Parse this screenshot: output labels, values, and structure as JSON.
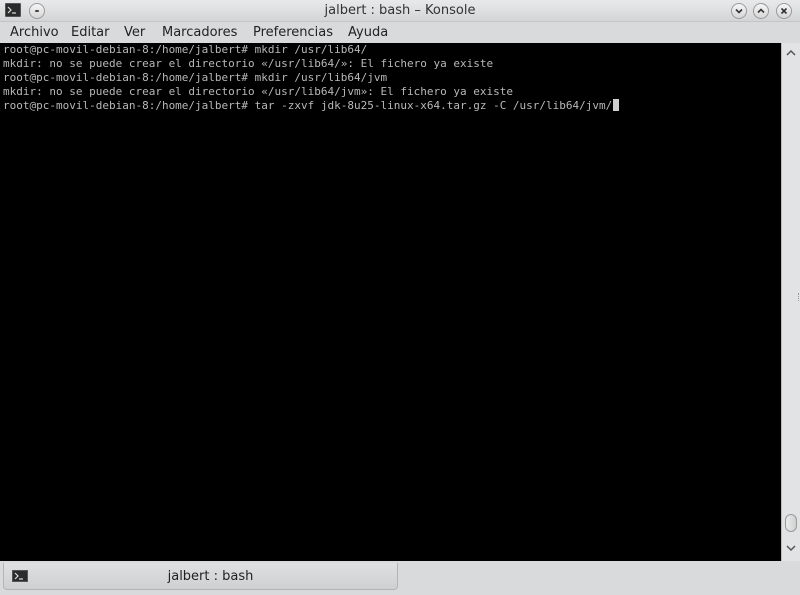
{
  "window": {
    "title": "jalbert : bash – Konsole"
  },
  "menubar": {
    "items": [
      "Archivo",
      "Editar",
      "Ver",
      "Marcadores",
      "Preferencias",
      "Ayuda"
    ]
  },
  "terminal": {
    "lines": [
      "root@pc-movil-debian-8:/home/jalbert# mkdir /usr/lib64/",
      "mkdir: no se puede crear el directorio «/usr/lib64/»: El fichero ya existe",
      "root@pc-movil-debian-8:/home/jalbert# mkdir /usr/lib64/jvm",
      "mkdir: no se puede crear el directorio «/usr/lib64/jvm»: El fichero ya existe",
      "root@pc-movil-debian-8:/home/jalbert# tar -zxvf jdk-8u25-linux-x64.tar.gz -C /usr/lib64/jvm/"
    ]
  },
  "tabs": [
    {
      "label": "jalbert : bash"
    }
  ],
  "icons": {
    "app": "terminal-icon",
    "window_menu": "window-menu-icon",
    "minimize": "minimize-icon",
    "maximize": "maximize-icon",
    "close": "close-icon",
    "tab": "terminal-icon"
  }
}
